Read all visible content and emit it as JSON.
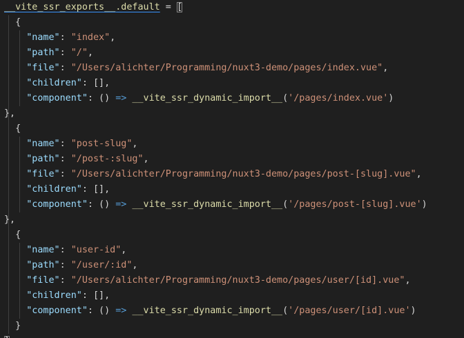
{
  "editor": {
    "root_var": "__vite_ssr_exports__",
    "root_member": ".default",
    "assign": " = ",
    "open_bracket": "[",
    "close_bracket": "]",
    "close_semicolon": ";",
    "open_brace": "{",
    "close_brace_comma": "},",
    "close_brace": "}",
    "routes": [
      {
        "name_key": "\"name\"",
        "name_val": "\"index\"",
        "path_key": "\"path\"",
        "path_val": "\"/\"",
        "file_key": "\"file\"",
        "file_val": "\"/Users/alichter/Programming/nuxt3-demo/pages/index.vue\"",
        "children_key": "\"children\"",
        "children_val": "[]",
        "component_key": "\"component\"",
        "component_params": "()",
        "arrow": "=>",
        "import_fn": "__vite_ssr_dynamic_import__",
        "import_arg": "'/pages/index.vue'"
      },
      {
        "name_key": "\"name\"",
        "name_val": "\"post-slug\"",
        "path_key": "\"path\"",
        "path_val": "\"/post-:slug\"",
        "file_key": "\"file\"",
        "file_val": "\"/Users/alichter/Programming/nuxt3-demo/pages/post-[slug].vue\"",
        "children_key": "\"children\"",
        "children_val": "[]",
        "component_key": "\"component\"",
        "component_params": "()",
        "arrow": "=>",
        "import_fn": "__vite_ssr_dynamic_import__",
        "import_arg": "'/pages/post-[slug].vue'"
      },
      {
        "name_key": "\"name\"",
        "name_val": "\"user-id\"",
        "path_key": "\"path\"",
        "path_val": "\"/user/:id\"",
        "file_key": "\"file\"",
        "file_val": "\"/Users/alichter/Programming/nuxt3-demo/pages/user/[id].vue\"",
        "children_key": "\"children\"",
        "children_val": "[]",
        "component_key": "\"component\"",
        "component_params": "()",
        "arrow": "=>",
        "import_fn": "__vite_ssr_dynamic_import__",
        "import_arg": "'/pages/user/[id].vue'"
      }
    ]
  }
}
